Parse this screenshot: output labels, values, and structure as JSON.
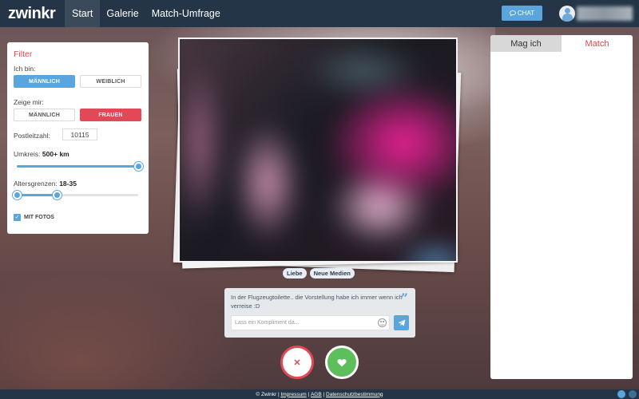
{
  "header": {
    "logo": "zwinkr",
    "nav": [
      "Start",
      "Galerie",
      "Match-Umfrage"
    ],
    "chat_label": "CHAT"
  },
  "filter": {
    "title": "Filter",
    "ich_bin_label": "Ich bin:",
    "ich_bin_options": [
      "MÄNNLICH",
      "WEIBLICH"
    ],
    "ich_bin_selected": "MÄNNLICH",
    "zeige_label": "Zeige mir:",
    "zeige_options": [
      "MÄNNLICH",
      "FRAUEN"
    ],
    "zeige_selected": "FRAUEN",
    "plz_label": "Postleitzahl:",
    "plz_value": "10115",
    "umkreis_label": "Umkreis:",
    "umkreis_value": "500+",
    "umkreis_unit": "km",
    "umkreis_fraction": 1.0,
    "alter_label": "Altersgrenzen:",
    "alter_value": "18-35",
    "alter_range_fraction": [
      0.0,
      0.33
    ],
    "mit_fotos_label": "MIT FOTOS",
    "mit_fotos_checked": true
  },
  "post": {
    "tags": [
      "Liebe",
      "Neue Medien"
    ],
    "comment": "In der Flugzeugtoilette.. die Vorstellung habe ich immer wenn ich verreise :D",
    "compliment_placeholder": "Lass ein Kompliment da..."
  },
  "right_panel": {
    "tabs": [
      "Mag ich",
      "Match"
    ],
    "active_tab": "Match"
  },
  "footer": {
    "copyright": "© Zwinkr |",
    "links": [
      "Impressum",
      "AGB",
      "Datenschutzbestimmung"
    ],
    "separator": "|"
  },
  "colors": {
    "brand_dark": "#243547",
    "accent_blue": "#5aa6dc",
    "accent_red": "#e44856",
    "like_green": "#5cbf5c"
  },
  "icons": [
    "chat-bubble-icon",
    "user-avatar-icon",
    "quote-icon",
    "smiley-icon",
    "send-icon",
    "close-icon",
    "heart-icon",
    "twitter-icon",
    "instagram-icon"
  ]
}
